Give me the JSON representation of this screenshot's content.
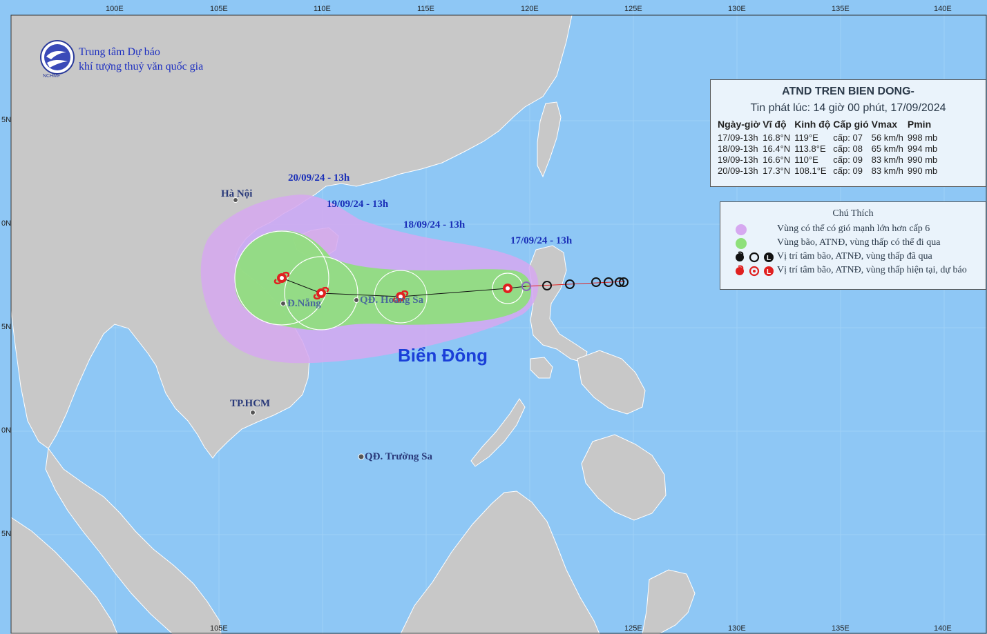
{
  "logo": {
    "short": "NCHMF",
    "line1": "Trung tâm Dự báo",
    "line2": "khí tượng thuỷ văn quốc gia"
  },
  "axis": {
    "top": [
      "100E",
      "105E",
      "110E",
      "115E",
      "120E",
      "125E",
      "130E",
      "135E",
      "140E"
    ],
    "bottom": [
      "105E",
      "125E",
      "130E",
      "135E",
      "140E"
    ],
    "left": [
      "5N",
      "0N",
      "5N",
      "0N",
      "5N"
    ]
  },
  "places": {
    "hanoi": "Hà Nội",
    "danang": "Đ.Nẵng",
    "hoangsa": "QĐ. Hoàng Sa",
    "hcm": "TP.HCM",
    "truongsa": "QĐ. Trường Sa",
    "sea": "Biển Đông"
  },
  "track_labels": {
    "t17": "17/09/24 - 13h",
    "t18": "18/09/24 - 13h",
    "t19": "19/09/24 - 13h",
    "t20": "20/09/24 - 13h"
  },
  "info": {
    "title": "ATND TREN BIEN DONG-",
    "issued": "Tin phát lúc: 14 giờ 00 phút, 17/09/2024",
    "headers": [
      "Ngày-giờ",
      "Vĩ độ",
      "Kinh độ",
      "Cấp gió",
      "Vmax",
      "Pmin"
    ],
    "rows": [
      [
        "17/09-13h",
        "16.8°N",
        "119°E",
        "cấp: 07",
        "56 km/h",
        "998 mb"
      ],
      [
        "18/09-13h",
        "16.4°N",
        "113.8°E",
        "cấp: 08",
        "65 km/h",
        "994 mb"
      ],
      [
        "19/09-13h",
        "16.6°N",
        "110°E",
        "cấp: 09",
        "83 km/h",
        "990 mb"
      ],
      [
        "20/09-13h",
        "17.3°N",
        "108.1°E",
        "cấp: 09",
        "83 km/h",
        "990 mb"
      ]
    ]
  },
  "legend": {
    "title": "Chú Thích",
    "items": [
      "Vùng có thể có gió mạnh lớn hơn cấp 6",
      "Vùng bão, ATNĐ, vùng thấp có thể đi qua",
      "Vị trí tâm bão, ATNĐ, vùng thấp đã qua",
      "Vị trí tâm bão, ATNĐ, vùng thấp hiện tại, dự báo"
    ],
    "glyphs": [
      "L"
    ]
  },
  "colors": {
    "sea": "#8ec7f5",
    "land": "#c8c8c8",
    "strong_wind_zone": "#d6a8f0",
    "storm_path_zone": "#8ee07a",
    "current_track": "#e02020",
    "past_track": "#111111"
  }
}
